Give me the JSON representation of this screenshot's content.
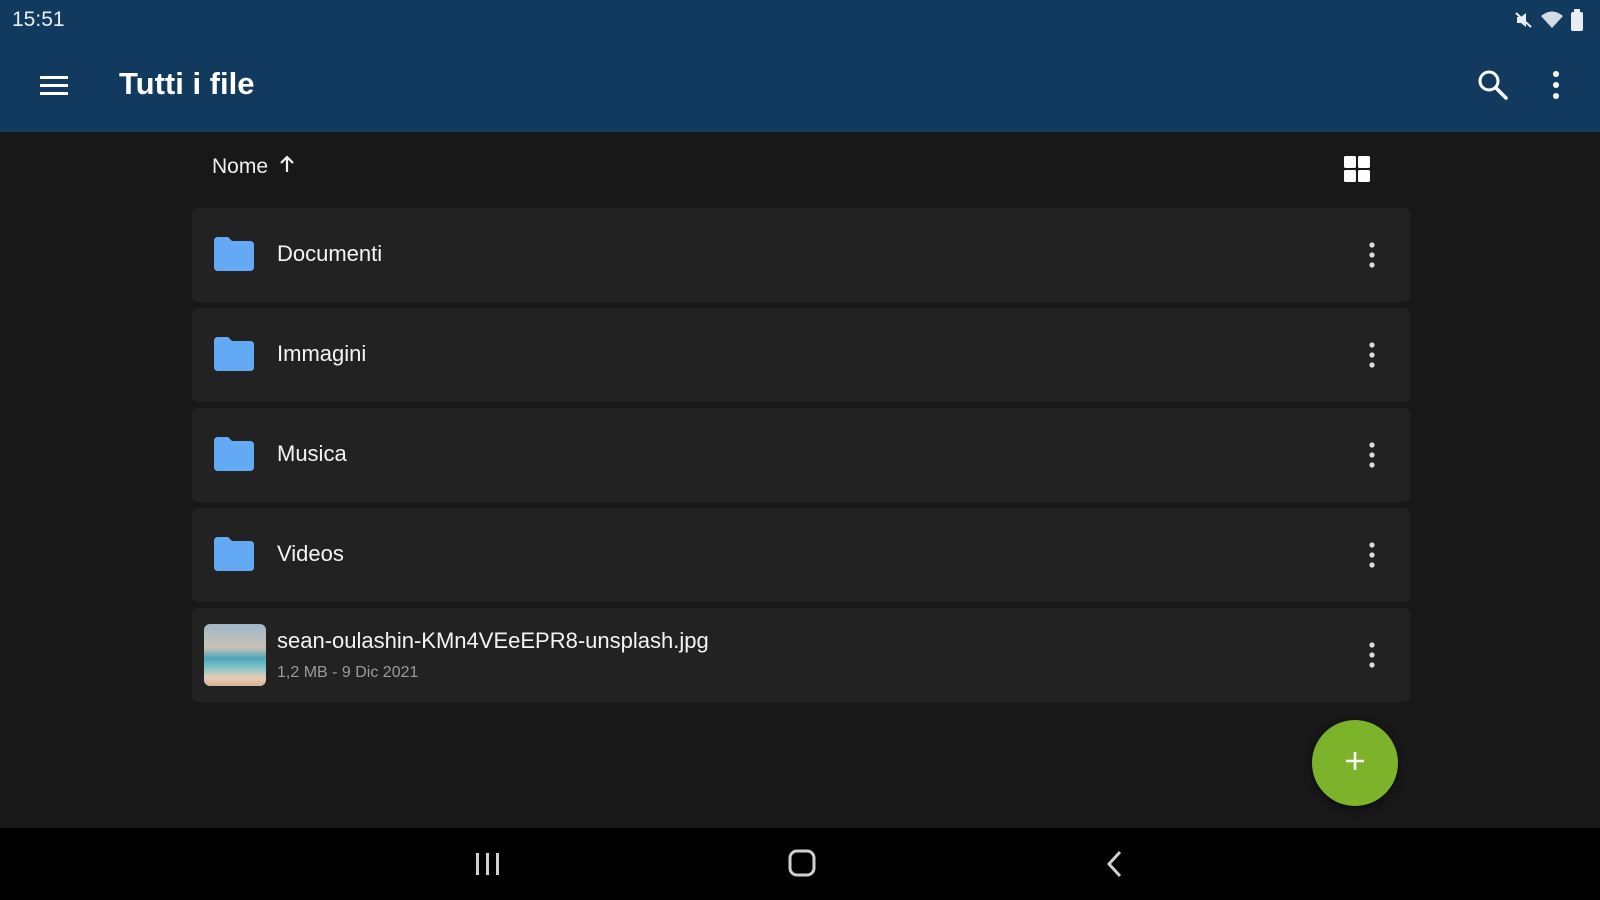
{
  "status_bar": {
    "time": "15:51",
    "icons": [
      "mute-icon",
      "wifi-icon",
      "battery-icon"
    ]
  },
  "app_bar": {
    "title": "Tutti i file",
    "icons": [
      "menu-icon",
      "search-icon",
      "more-vert-icon"
    ]
  },
  "sort": {
    "label": "Nome",
    "direction_icon": "arrow-up-icon",
    "view_toggle_icon": "grid-view-icon"
  },
  "items": [
    {
      "type": "folder",
      "name": "Documenti"
    },
    {
      "type": "folder",
      "name": "Immagini"
    },
    {
      "type": "folder",
      "name": "Musica"
    },
    {
      "type": "folder",
      "name": "Videos"
    },
    {
      "type": "file",
      "name": "sean-oulashin-KMn4VEeEPR8-unsplash.jpg",
      "meta": "1,2 MB - 9 Dic 2021"
    }
  ],
  "fab": {
    "icon": "plus-icon"
  },
  "nav_bar": {
    "icons": [
      "recents-icon",
      "home-icon",
      "back-icon"
    ]
  },
  "colors": {
    "app_bar": "#123a5e",
    "background": "#181818",
    "row": "#222222",
    "folder": "#64a9f3",
    "fab": "#7cb32a"
  }
}
